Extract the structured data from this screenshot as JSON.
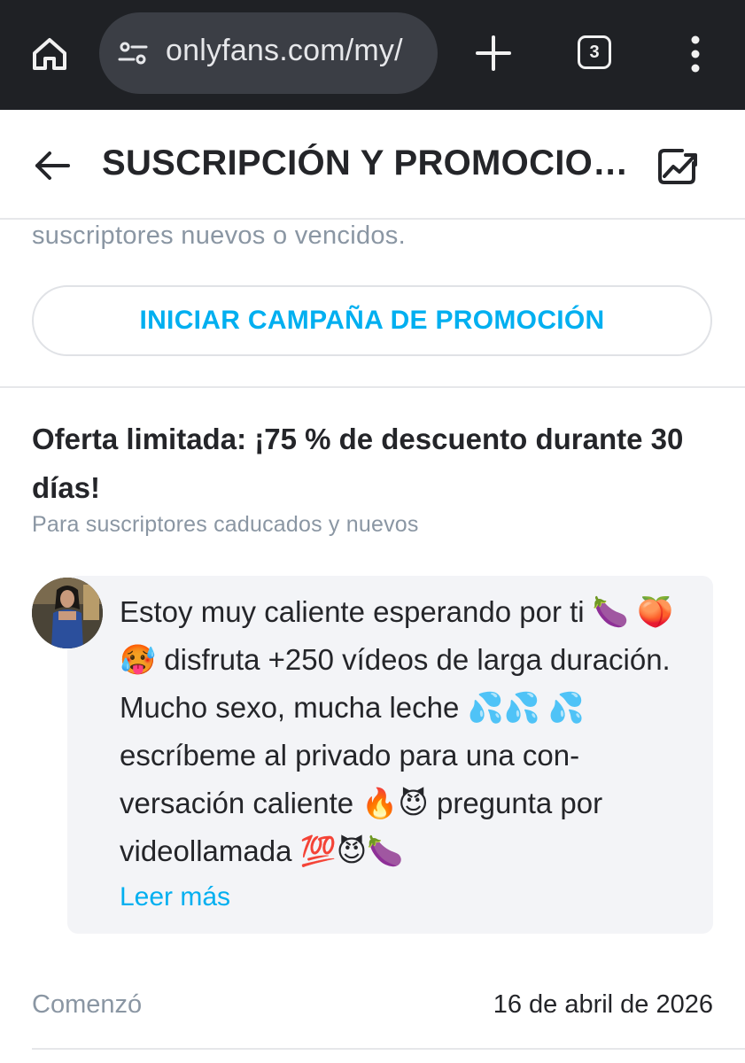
{
  "browser": {
    "url": "onlyfans.com/my/",
    "tab_count": "3"
  },
  "header": {
    "title": "SUSCRIPCIÓN Y PROMOCIONES"
  },
  "section": {
    "prev_description": "suscriptores nuevos o vencidos.",
    "start_campaign_label": "INICIAR CAMPAÑA DE PROMOCIÓN"
  },
  "offer": {
    "title": "Oferta limitada: ¡75 % de descuento durante 30 días!",
    "subtitle": "Para suscriptores caducados y nuevos",
    "message": "Estoy muy caliente esperando por ti 🍆 🍑🥵 disfruta +250 vídeos de larga du­ración. Mucho sexo, mucha leche 💦💦 💦 escríbeme al privado para una con­versación caliente 🔥😈 pregunta por videollamada 💯😈🍆",
    "read_more_label": "Leer más",
    "started_label": "Comenzó",
    "started_value": "16 de abril de 2026"
  },
  "colors": {
    "accent": "#00aff0",
    "muted_text": "#8a96a3",
    "browser_bar": "#1f2125"
  }
}
